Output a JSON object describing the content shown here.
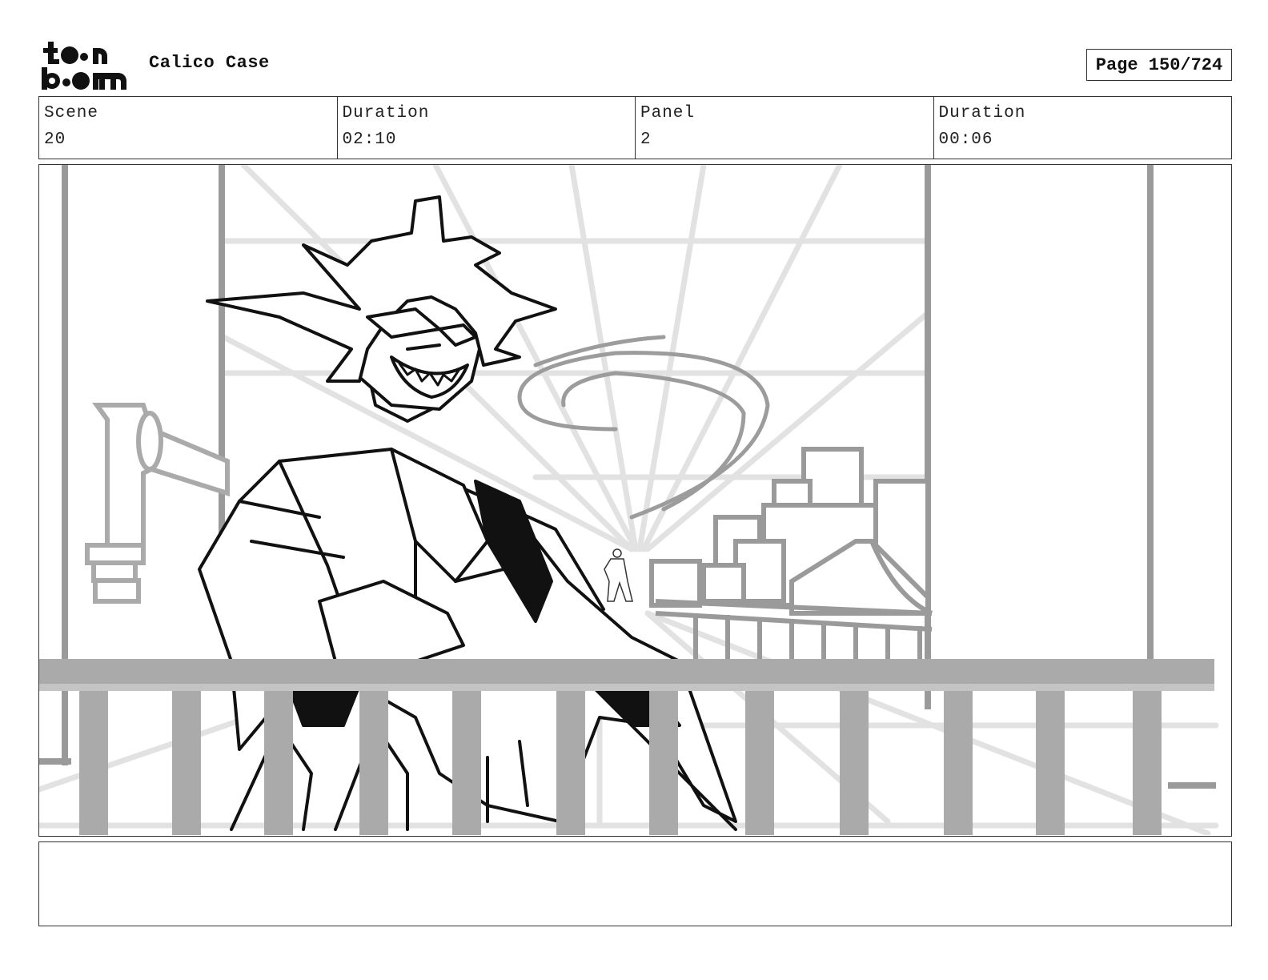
{
  "header": {
    "logo_text": "toonboom",
    "project_title": "Calico Case",
    "page_label": "Page 150/724"
  },
  "info": {
    "scene_label": "Scene",
    "scene_value": "20",
    "scene_duration_label": "Duration",
    "scene_duration_value": "02:10",
    "panel_label": "Panel",
    "panel_value": "2",
    "panel_duration_label": "Duration",
    "panel_duration_value": "00:06"
  },
  "notes": {
    "text": ""
  }
}
